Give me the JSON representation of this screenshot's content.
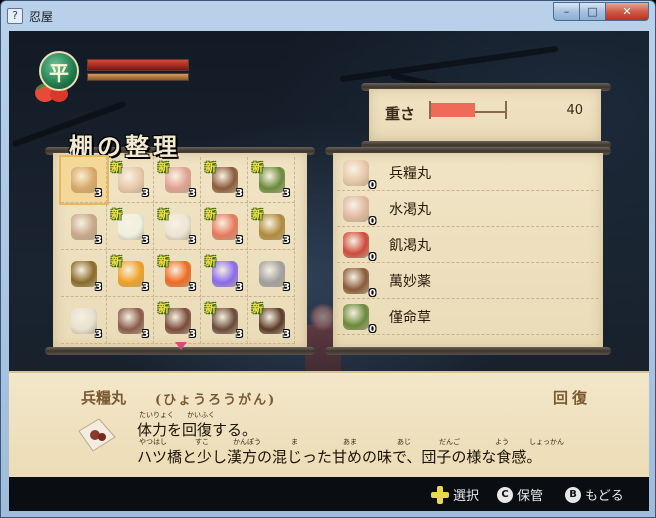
{
  "window": {
    "title": "忍屋",
    "buttons": {
      "minimize": "–",
      "maximize": "□",
      "close": "✕"
    }
  },
  "status": {
    "emblem_char": "平",
    "hp_fraction": 1.0,
    "sp_fraction": 1.0
  },
  "weight": {
    "label": "重さ",
    "value": "40",
    "fill_fraction": 0.6
  },
  "shelf": {
    "title": "棚の整理",
    "grid": [
      {
        "icon": "scroll-pill-icon",
        "color": "#d8a86a",
        "qty": "3",
        "new": false,
        "selected": true
      },
      {
        "icon": "paper-pill-icon",
        "color": "#e8c8a8",
        "qty": "3",
        "new": true
      },
      {
        "icon": "paper-red-pill-icon",
        "color": "#e0a090",
        "qty": "3",
        "new": true
      },
      {
        "icon": "pouch-icon",
        "color": "#8a5a3a",
        "qty": "3",
        "new": true
      },
      {
        "icon": "herb-icon",
        "color": "#6a8a3a",
        "qty": "3",
        "new": true
      },
      {
        "icon": "mushroom-icon",
        "color": "#c8a888",
        "qty": "3",
        "new": false
      },
      {
        "icon": "rice-ball-icon",
        "color": "#f0f0e0",
        "qty": "3",
        "new": true
      },
      {
        "icon": "round-rice-ball-icon",
        "color": "#ece4d4",
        "qty": "3",
        "new": true
      },
      {
        "icon": "feather-icon",
        "color": "#e8785a",
        "qty": "3",
        "new": true
      },
      {
        "icon": "straw-hat-icon",
        "color": "#b08a3a",
        "qty": "3",
        "new": true
      },
      {
        "icon": "log-icon",
        "color": "#8a6a2a",
        "qty": "3",
        "new": false
      },
      {
        "icon": "gourd-icon",
        "color": "#f0a020",
        "qty": "3",
        "new": true
      },
      {
        "icon": "fire-orb-icon",
        "color": "#f06a20",
        "qty": "3",
        "new": true
      },
      {
        "icon": "crystal-orb-icon",
        "color": "#8a6af0",
        "qty": "3",
        "new": true
      },
      {
        "icon": "key-icon",
        "color": "#a0a0a0",
        "qty": "3",
        "new": false
      },
      {
        "icon": "letter-icon",
        "color": "#e8e0d0",
        "qty": "3",
        "new": false
      },
      {
        "icon": "gauntlet-icon",
        "color": "#8a5a4a",
        "qty": "3",
        "new": false
      },
      {
        "icon": "gauntlet-icon",
        "color": "#7a4a3a",
        "qty": "3",
        "new": true
      },
      {
        "icon": "gauntlet-icon",
        "color": "#6a4a3a",
        "qty": "3",
        "new": true
      },
      {
        "icon": "gauntlet-icon",
        "color": "#5a3a2a",
        "qty": "3",
        "new": true
      }
    ]
  },
  "storage": {
    "items": [
      {
        "name": "兵糧丸",
        "qty": "0",
        "icon": "paper-pill-icon",
        "color": "#e8c8a8"
      },
      {
        "name": "水渇丸",
        "qty": "0",
        "icon": "paper-pill-icon",
        "color": "#e0b8a0"
      },
      {
        "name": "飢渇丸",
        "qty": "0",
        "icon": "red-pill-icon",
        "color": "#d04a3a"
      },
      {
        "name": "萬妙薬",
        "qty": "0",
        "icon": "pouch-icon",
        "color": "#8a5a3a"
      },
      {
        "name": "僅命草",
        "qty": "0",
        "icon": "herb-icon",
        "color": "#6a8a3a"
      }
    ]
  },
  "description": {
    "name": "兵糧丸",
    "reading": "(ひょうろうがん)",
    "category": "回復",
    "line1": "体力を回復する。",
    "line2": "ハツ橋と少し漢方の混じった甘めの味で、団子の様な食感。",
    "ruby": [
      {
        "text": "たいりょく"
      },
      {
        "text": "かいふく"
      },
      {
        "text": "やつはし"
      },
      {
        "text": "すこ"
      },
      {
        "text": "かんぽう"
      },
      {
        "text": "ま"
      },
      {
        "text": "あま"
      },
      {
        "text": "あじ"
      },
      {
        "text": "だんご"
      },
      {
        "text": "よう"
      },
      {
        "text": "しょっかん"
      }
    ]
  },
  "footer": {
    "select_label": "選択",
    "store_button": "C",
    "store_label": "保管",
    "back_button": "B",
    "back_label": "もどる"
  }
}
